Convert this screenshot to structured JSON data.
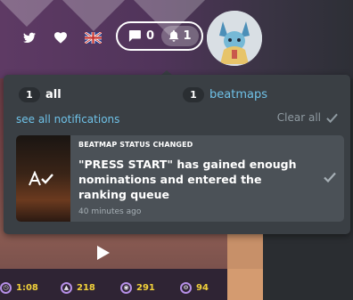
{
  "nav": {
    "twitter_icon": "twitter-icon",
    "heart_icon": "heart-icon",
    "language_flag": "uk-flag-icon",
    "chat_count": "0",
    "notification_count": "1"
  },
  "notifications": {
    "tabs": [
      {
        "count": "1",
        "label": "all"
      },
      {
        "count": "1",
        "label": "beatmaps"
      }
    ],
    "see_all": "see all notifications",
    "clear_all": "Clear all",
    "items": [
      {
        "type": "BEATMAP STATUS CHANGED",
        "message": "\"PRESS START\" has gained enough nominations and entered the ranking queue",
        "time": "40 minutes ago"
      }
    ]
  },
  "beatmap_stats": {
    "length": "1:08",
    "circles": "218",
    "sliders": "291",
    "spinners": "94"
  },
  "colors": {
    "accent_blue": "#6fc2e8",
    "stat_yellow": "#f2d23a",
    "dropdown_bg": "#3a3f44",
    "card_bg": "#4b5157"
  }
}
